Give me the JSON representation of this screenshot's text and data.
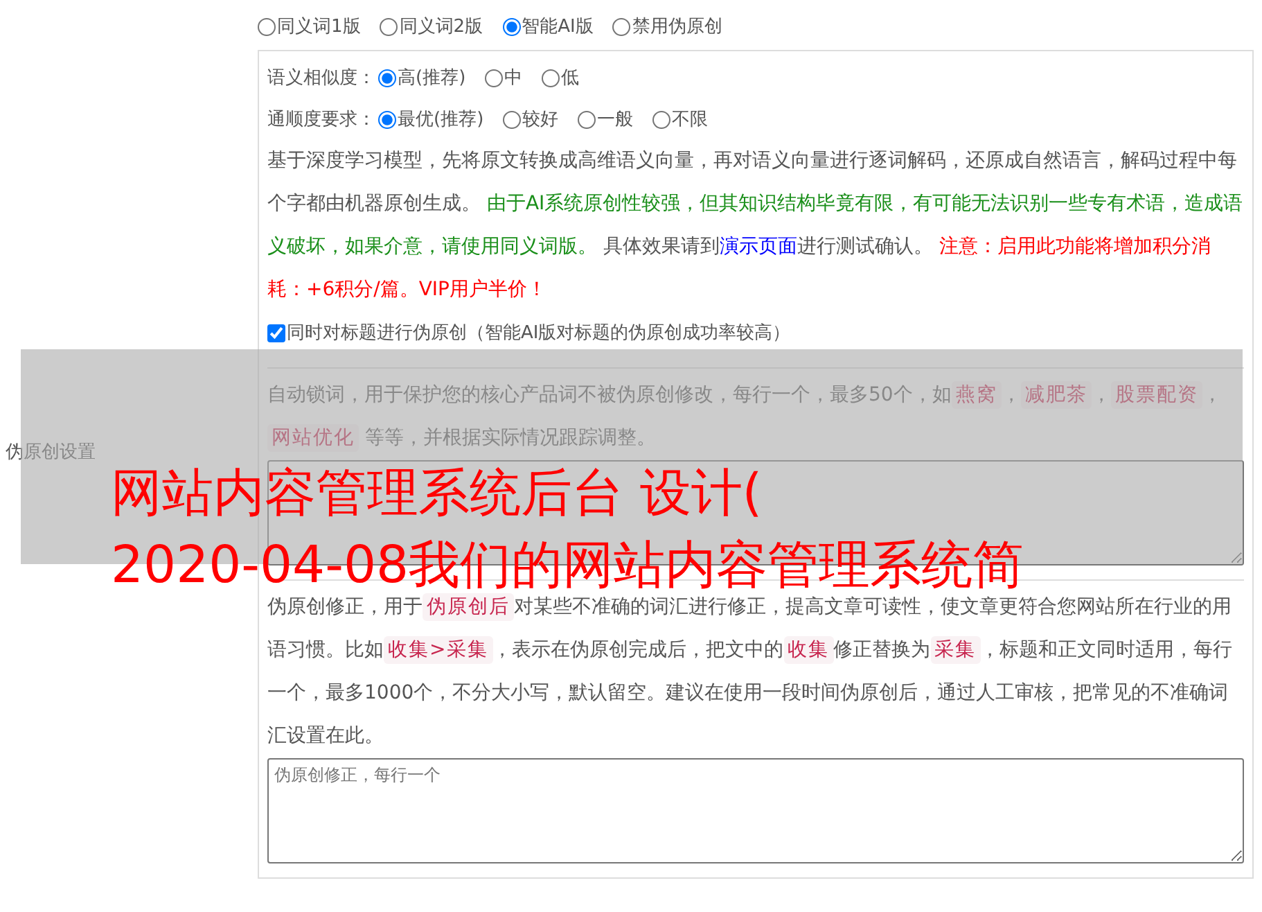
{
  "section_label": "伪原创设置",
  "mode_options": [
    {
      "label": "同义词1版",
      "selected": false
    },
    {
      "label": "同义词2版",
      "selected": false
    },
    {
      "label": "智能AI版",
      "selected": true
    },
    {
      "label": "禁用伪原创",
      "selected": false
    }
  ],
  "similarity": {
    "label": "语义相似度：",
    "options": [
      {
        "label": "高(推荐)",
        "selected": true
      },
      {
        "label": "中",
        "selected": false
      },
      {
        "label": "低",
        "selected": false
      }
    ]
  },
  "fluency": {
    "label": "通顺度要求：",
    "options": [
      {
        "label": "最优(推荐)",
        "selected": true
      },
      {
        "label": "较好",
        "selected": false
      },
      {
        "label": "一般",
        "selected": false
      },
      {
        "label": "不限",
        "selected": false
      }
    ]
  },
  "ai_description": [
    {
      "kind": "text",
      "text": "基于深度学习模型，先将原文转换成高维语义向量，再对语义向量进行逐词解码，还原成自然语言，解码过程中每个字都由机器原创生成。 "
    },
    {
      "kind": "green",
      "text": "由于AI系统原创性较强，但其知识结构毕竟有限，有可能无法识别一些专有术语，造成语义破坏，如果介意，请使用同义词版。"
    },
    {
      "kind": "text",
      "text": " 具体效果请到"
    },
    {
      "kind": "link",
      "text": "演示页面"
    },
    {
      "kind": "text",
      "text": "进行测试确认。 "
    },
    {
      "kind": "red",
      "text": "注意：启用此功能将增加积分消耗：+6积分/篇。VIP用户半价！"
    }
  ],
  "title_option": {
    "label": "同时对标题进行伪原创（智能AI版对标题的伪原创成功率较高）",
    "checked": true
  },
  "lock_words": {
    "description": [
      {
        "kind": "text",
        "text": "自动锁词，用于保护您的核心产品词不被伪原创修改，每行一个，最多50个，如"
      },
      {
        "kind": "code",
        "text": "燕窝"
      },
      {
        "kind": "text",
        "text": "，"
      },
      {
        "kind": "code",
        "text": "减肥茶"
      },
      {
        "kind": "text",
        "text": "，"
      },
      {
        "kind": "code",
        "text": "股票配资"
      },
      {
        "kind": "text",
        "text": "，"
      },
      {
        "kind": "code",
        "text": "网站优化"
      },
      {
        "kind": "text",
        "text": " 等等，并根据实际情况跟踪调整。"
      }
    ]
  },
  "correction": {
    "description": [
      {
        "kind": "text",
        "text": "伪原创修正，用于"
      },
      {
        "kind": "code",
        "text": "伪原创后"
      },
      {
        "kind": "text",
        "text": "对某些不准确的词汇进行修正，提高文章可读性，使文章更符合您网站所在行业的用语习惯。比如"
      },
      {
        "kind": "code",
        "text": "收集>采集"
      },
      {
        "kind": "text",
        "text": "，表示在伪原创完成后，把文中的"
      },
      {
        "kind": "code",
        "text": "收集"
      },
      {
        "kind": "text",
        "text": "修正替换为"
      },
      {
        "kind": "code",
        "text": "采集"
      },
      {
        "kind": "text",
        "text": "，标题和正文同时适用，每行一个，最多1000个，不分大小写，默认留空。建议在使用一段时间伪原创后，通过人工审核，把常见的不准确词汇设置在此。"
      }
    ],
    "placeholder": "伪原创修正，每行一个"
  },
  "overlay_banner": {
    "lines": [
      "网站内容管理系统后台 设计(",
      "2020-04-08我们的网站内容管理系统简"
    ]
  }
}
